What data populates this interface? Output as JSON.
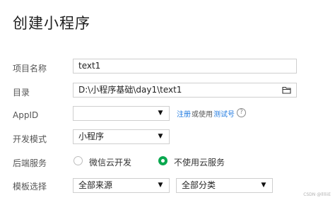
{
  "title": "创建小程序",
  "form": {
    "project_name": {
      "label": "项目名称",
      "value": "text1"
    },
    "directory": {
      "label": "目录",
      "value": "D:\\小程序基础\\day1\\text1",
      "icon": "folder-icon"
    },
    "appid": {
      "label": "AppID",
      "value": "",
      "register_link": "注册",
      "or_use_text": "或使用",
      "test_account_link": "测试号",
      "help_icon": "question-icon"
    },
    "dev_mode": {
      "label": "开发模式",
      "value": "小程序"
    },
    "backend": {
      "label": "后端服务",
      "options": [
        "微信云开发",
        "不使用云服务"
      ],
      "selected_index": 1
    },
    "template": {
      "label": "模板选择",
      "source_value": "全部来源",
      "category_value": "全部分类"
    }
  },
  "watermark": "CSDN @lllliiE"
}
